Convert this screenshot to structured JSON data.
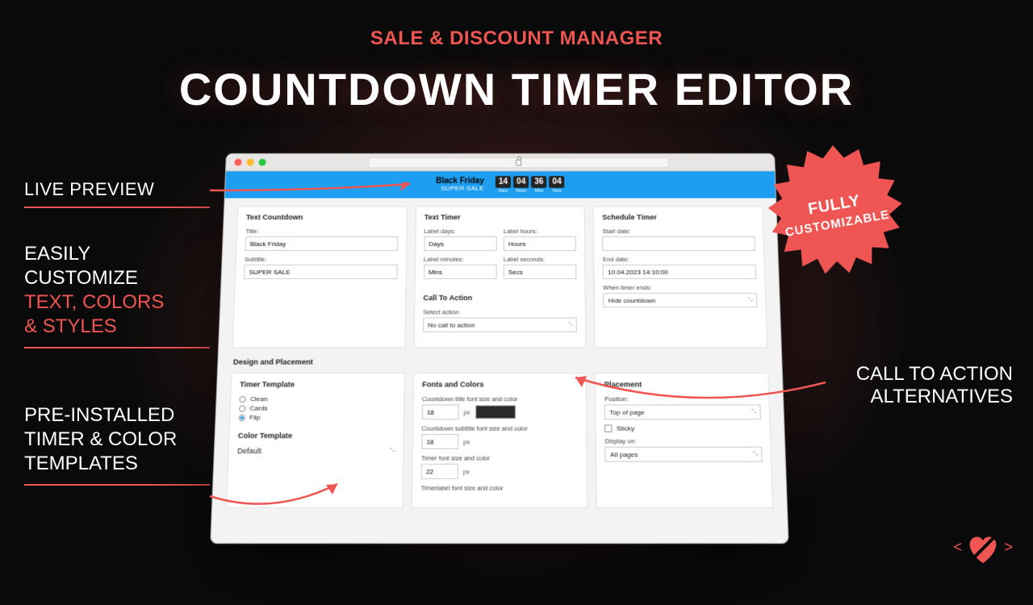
{
  "hero": {
    "subtitle": "SALE & DISCOUNT MANAGER",
    "title": "COUNTDOWN TIMER EDITOR"
  },
  "callouts": {
    "live": "LIVE PREVIEW",
    "customize_l1": "EASILY",
    "customize_l2": "CUSTOMIZE",
    "customize_l3": "TEXT, COLORS",
    "customize_l4": "& STYLES",
    "templates_l1": "PRE-INSTALLED",
    "templates_l2": "TIMER & COLOR",
    "templates_l3": "TEMPLATES",
    "cta_l1": "CALL TO ACTION",
    "cta_l2": "ALTERNATIVES",
    "badge_l1": "FULLY",
    "badge_l2": "CUSTOMIZABLE"
  },
  "banner": {
    "title": "Black Friday",
    "subtitle": "SUPER SALE",
    "digits": [
      {
        "val": "14",
        "label": "Days"
      },
      {
        "val": "04",
        "label": "Hours"
      },
      {
        "val": "36",
        "label": "Mins"
      },
      {
        "val": "04",
        "label": "Secs"
      }
    ]
  },
  "editor": {
    "text_countdown": {
      "heading": "Text Countdown",
      "title_label": "Title:",
      "title_value": "Black Friday",
      "subtitle_label": "Subtitle:",
      "subtitle_value": "SUPER SALE"
    },
    "text_timer": {
      "heading": "Text Timer",
      "days_label": "Label days:",
      "days_value": "Days",
      "hours_label": "Label hours:",
      "hours_value": "Hours",
      "mins_label": "Label minutes:",
      "mins_value": "Mins",
      "secs_label": "Label seconds:",
      "secs_value": "Secs"
    },
    "cta": {
      "heading": "Call To Action",
      "select_label": "Select action:",
      "select_value": "No call to action"
    },
    "schedule": {
      "heading": "Schedule Timer",
      "start_label": "Start date:",
      "start_value": "",
      "end_label": "End date:",
      "end_value": "10.04.2023 14:10:00",
      "ends_label": "When timer ends:",
      "ends_value": "Hide countdown"
    },
    "design_heading": "Design and Placement",
    "template": {
      "heading": "Timer Template",
      "opt1": "Clean",
      "opt2": "Cards",
      "opt3": "Flip",
      "color_heading": "Color Template",
      "color_value": "Default"
    },
    "fonts": {
      "heading": "Fonts and Colors",
      "title_row": "Countdown title font size and color",
      "title_size": "18",
      "subtitle_row": "Countdown subtitle font size and color",
      "subtitle_size": "18",
      "timer_row": "Timer font size and color",
      "timer_size": "22",
      "label_row": "Timerlabel font size and color",
      "unit": "px"
    },
    "placement": {
      "heading": "Placement",
      "pos_label": "Position:",
      "pos_value": "Top of page",
      "sticky": "Sticky",
      "display_label": "Display on:",
      "display_value": "All pages"
    }
  }
}
